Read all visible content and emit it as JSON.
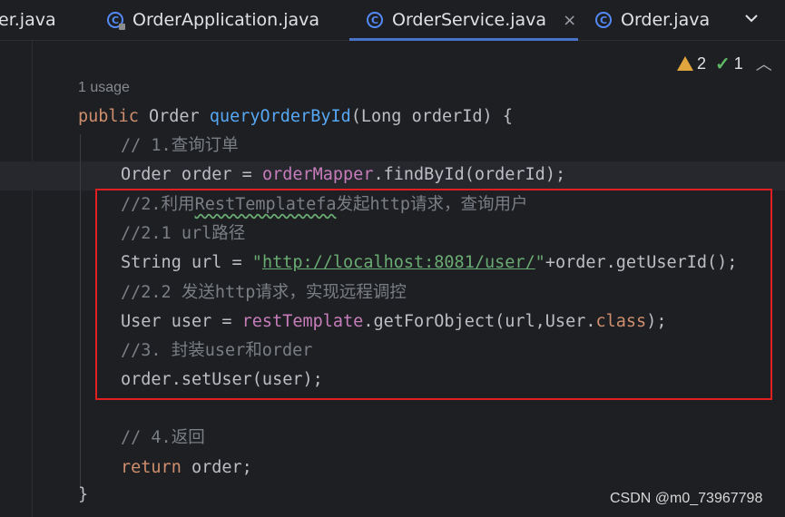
{
  "tabs": [
    {
      "label": "er.java"
    },
    {
      "label": "OrderApplication.java"
    },
    {
      "label": "OrderService.java",
      "active": true
    },
    {
      "label": "Order.java"
    }
  ],
  "tab_close": "×",
  "inspections": {
    "warnings": "2",
    "weak_warnings": "1"
  },
  "usage_hint": "1 usage",
  "code": {
    "l1": [
      "public",
      "Order",
      "queryOrderById",
      "(Long orderId) {"
    ],
    "l2": "// 1.查询订单",
    "l3": [
      "Order order = ",
      "orderMapper",
      ".findById(orderId);"
    ],
    "l4": [
      "//2.利用",
      "RestTemplatefa",
      "发起http请求，查询用户"
    ],
    "l5": "//2.1 url路径",
    "l6": [
      "String url = ",
      "\"",
      "http://localhost:8081/user/",
      "\"",
      "+order.getUserId();"
    ],
    "l7": "//2.2 发送http请求，实现远程调控",
    "l8": [
      "User user = ",
      "restTemplate",
      ".getForObject(url,User.",
      "class",
      ");"
    ],
    "l9": "//3. 封装user和order",
    "l10": "order.setUser(user);",
    "l11": "// 4.返回",
    "l12": [
      "return",
      " order;"
    ],
    "l13": "}"
  },
  "watermark": "CSDN @m0_73967798",
  "colors": {
    "keyword": "#cf8e6d",
    "method": "#56a8f5",
    "field": "#c77dbb",
    "comment": "#7a7e85",
    "string": "#6aab73",
    "highlight_box": "#e02020"
  }
}
